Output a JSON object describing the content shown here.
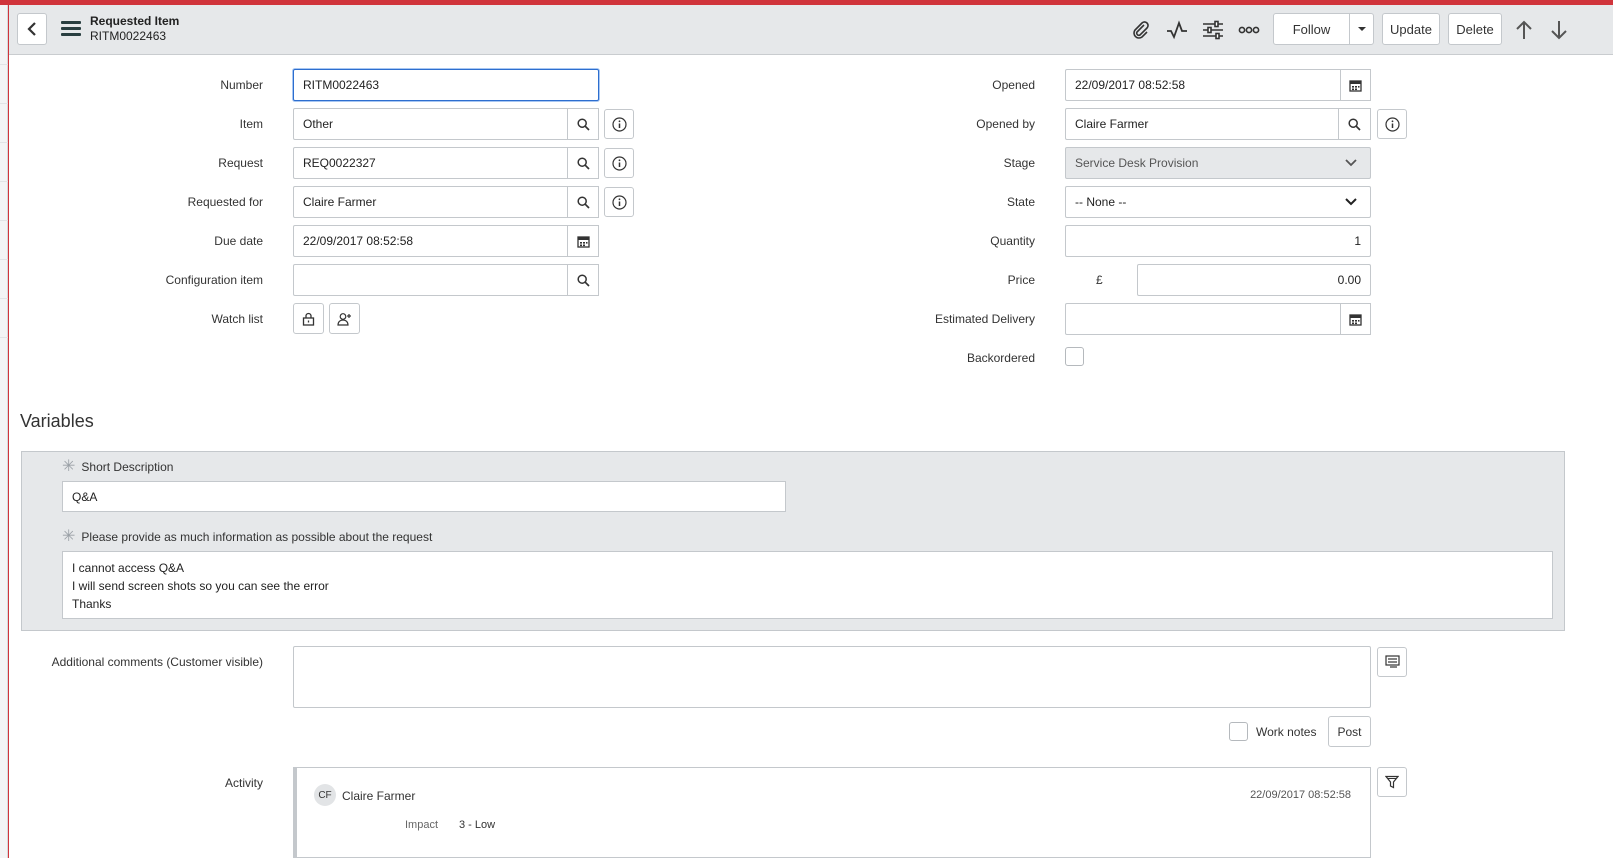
{
  "header": {
    "title": "Requested Item",
    "subtitle": "RITM0022463",
    "follow_label": "Follow",
    "update_label": "Update",
    "delete_label": "Delete"
  },
  "form": {
    "left": {
      "number": {
        "label": "Number",
        "value": "RITM0022463"
      },
      "item": {
        "label": "Item",
        "value": "Other"
      },
      "request": {
        "label": "Request",
        "value": "REQ0022327"
      },
      "requested_for": {
        "label": "Requested for",
        "value": "Claire Farmer"
      },
      "due_date": {
        "label": "Due date",
        "value": "22/09/2017 08:52:58"
      },
      "configuration_item": {
        "label": "Configuration item",
        "value": ""
      },
      "watch_list": {
        "label": "Watch list"
      }
    },
    "right": {
      "opened": {
        "label": "Opened",
        "value": "22/09/2017 08:52:58"
      },
      "opened_by": {
        "label": "Opened by",
        "value": "Claire Farmer"
      },
      "stage": {
        "label": "Stage",
        "value": "Service Desk Provision"
      },
      "state": {
        "label": "State",
        "value": "-- None --"
      },
      "quantity": {
        "label": "Quantity",
        "value": "1"
      },
      "price": {
        "label": "Price",
        "currency": "£",
        "value": "0.00"
      },
      "estimated_delivery": {
        "label": "Estimated Delivery",
        "value": ""
      },
      "backordered": {
        "label": "Backordered",
        "checked": false
      }
    }
  },
  "variables": {
    "title": "Variables",
    "short_description": {
      "label": "Short Description",
      "value": "Q&A"
    },
    "details": {
      "label": "Please provide as much information as possible about the request",
      "lines": [
        "I cannot access Q&A",
        "I will send screen shots so you can see the error",
        "Thanks"
      ]
    }
  },
  "comments": {
    "label": "Additional comments (Customer visible)",
    "value": "",
    "work_notes_label": "Work notes",
    "post_label": "Post"
  },
  "activity": {
    "label": "Activity",
    "entry": {
      "initials": "CF",
      "user": "Claire Farmer",
      "timestamp": "22/09/2017 08:52:58",
      "field_label": "Impact",
      "field_value": "3 - Low"
    }
  },
  "colors": {
    "brand_red": "#d0343b",
    "focus_blue": "#2d6ecf",
    "header_bg": "#e6e8ea"
  }
}
